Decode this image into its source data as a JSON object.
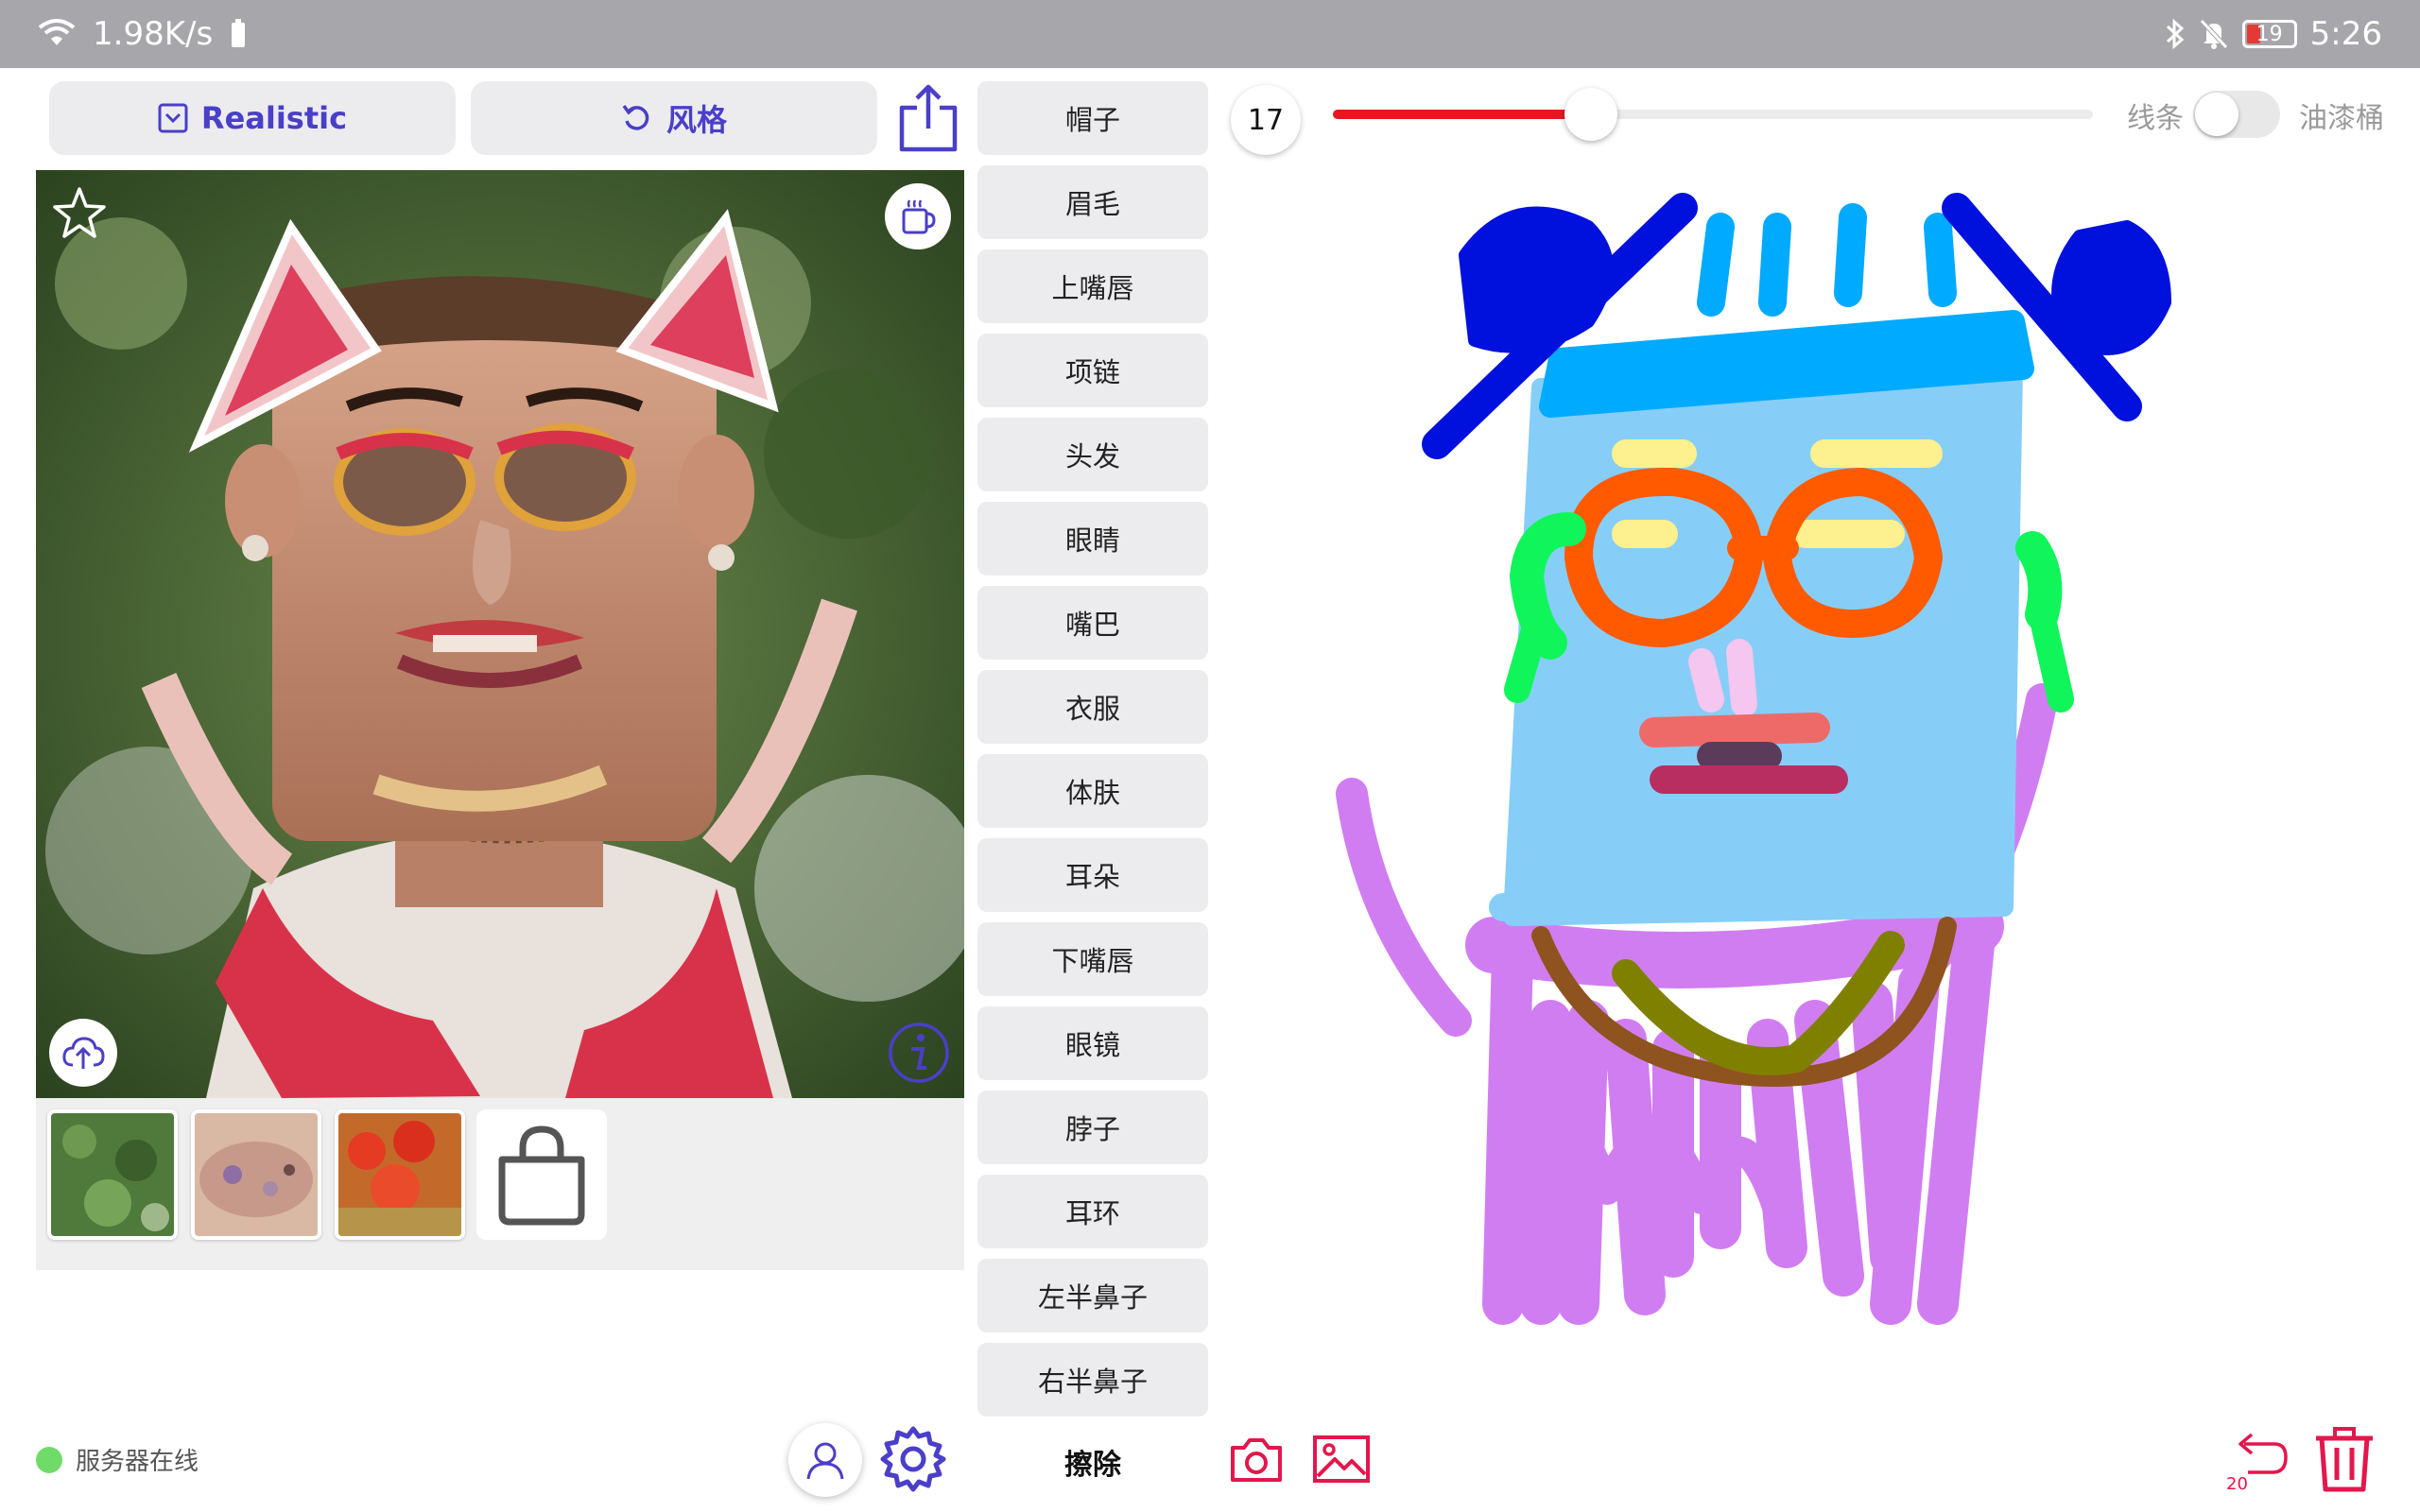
{
  "status_bar": {
    "net_speed": "1.98K/s",
    "battery_level": "19",
    "time": "5:26",
    "icons": [
      "wifi-icon",
      "battery-small-icon",
      "bluetooth-icon",
      "mute-bell-icon",
      "battery-icon"
    ]
  },
  "toolbar": {
    "realistic_label": "Realistic",
    "style_label": "风格",
    "share_icon": "share-icon"
  },
  "parts": [
    "帽子",
    "眉毛",
    "上嘴唇",
    "项链",
    "头发",
    "眼睛",
    "嘴巴",
    "衣服",
    "体肤",
    "耳朵",
    "下嘴唇",
    "眼镜",
    "脖子",
    "耳环",
    "左半鼻子",
    "右半鼻子"
  ],
  "erase_label": "擦除",
  "brush": {
    "size": "17",
    "slider_fraction": 0.34,
    "line_label": "线条",
    "fill_label": "油漆桶",
    "fill_mode_on": false
  },
  "colors": {
    "accent": "#4a3fc8",
    "slider_red": "#e8171f",
    "undo_red": "#e3174c",
    "server_green": "#6fdc6a"
  },
  "server": {
    "status_text": "服务器在线"
  },
  "undo": {
    "count": "20"
  },
  "thumbnails": [
    "green-foliage",
    "pink-stone",
    "red-flowers"
  ]
}
